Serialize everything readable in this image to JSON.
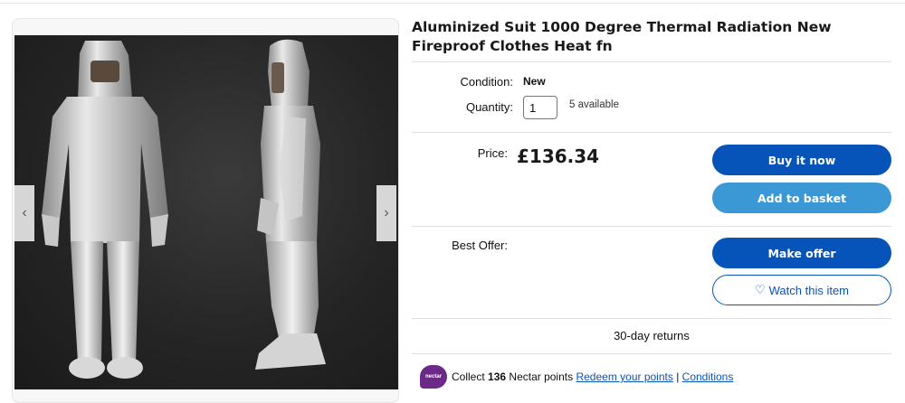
{
  "gallery": {
    "prev_icon": "chevron-left-icon",
    "next_icon": "chevron-right-icon",
    "prev_glyph": "‹",
    "next_glyph": "›"
  },
  "listing": {
    "title": "Aluminized Suit 1000 Degree Thermal Radiation New Fireproof Clothes Heat fn",
    "condition_label": "Condition:",
    "condition_value": "New",
    "quantity_label": "Quantity:",
    "quantity_value": "1",
    "available_text": "5 available",
    "price_label": "Price:",
    "price_value": "£136.34",
    "best_offer_label": "Best Offer:",
    "returns_text": "30-day returns"
  },
  "actions": {
    "buy_now": "Buy it now",
    "add_to_basket": "Add to basket",
    "make_offer": "Make offer",
    "watch": "Watch this item",
    "watch_icon": "heart-icon"
  },
  "nectar": {
    "logo_text": "nectar",
    "collect_prefix": "Collect",
    "points": "136",
    "points_suffix": "Nectar points",
    "redeem_link": "Redeem your points",
    "separator": "|",
    "conditions_link": "Conditions"
  },
  "colors": {
    "primary_button": "#0654ba",
    "secondary_button": "#3b98d4",
    "nectar_purple": "#6b2a88"
  }
}
